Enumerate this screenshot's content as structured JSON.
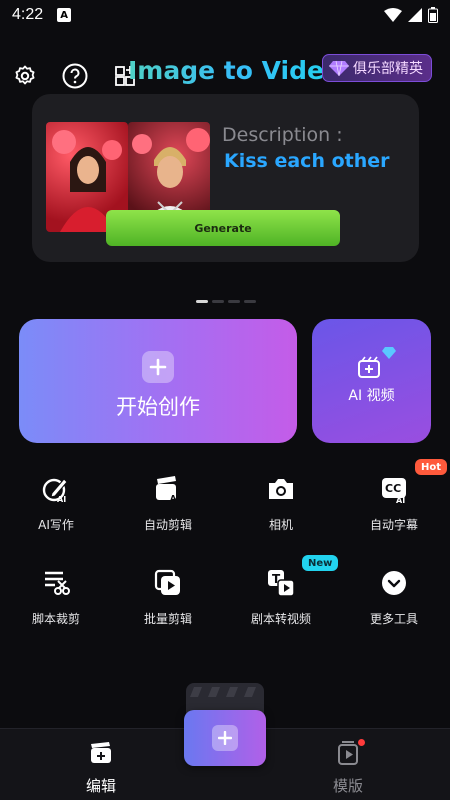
{
  "status_bar": {
    "time": "4:22",
    "notification_letter": "A"
  },
  "header": {
    "title": "Image to Video",
    "club_badge": "俱乐部精英"
  },
  "banner": {
    "description_label": "Description :",
    "description_value": "Kiss each other",
    "generate_label": "Generate",
    "page_count": 4,
    "active_page": 1
  },
  "main_actions": {
    "start_create": "开始创作",
    "ai_video": "AI 视频"
  },
  "tools": [
    {
      "label": "AI写作",
      "icon": "ai-write-icon",
      "tag": ""
    },
    {
      "label": "自动剪辑",
      "icon": "auto-edit-icon",
      "tag": ""
    },
    {
      "label": "相机",
      "icon": "camera-icon",
      "tag": ""
    },
    {
      "label": "自动字幕",
      "icon": "auto-caption-icon",
      "tag": "Hot"
    },
    {
      "label": "脚本裁剪",
      "icon": "script-cut-icon",
      "tag": ""
    },
    {
      "label": "批量剪辑",
      "icon": "batch-edit-icon",
      "tag": ""
    },
    {
      "label": "剧本转视频",
      "icon": "script-to-video-icon",
      "tag": "New"
    },
    {
      "label": "更多工具",
      "icon": "more-tools-icon",
      "tag": ""
    }
  ],
  "bottom_nav": {
    "edit_label": "编辑",
    "template_label": "模版"
  },
  "colors": {
    "accent_purple": "#a46ff2",
    "generate_green": "#6fcf34",
    "hot_tag": "#ff5a3c",
    "new_tag": "#22d3ee"
  }
}
